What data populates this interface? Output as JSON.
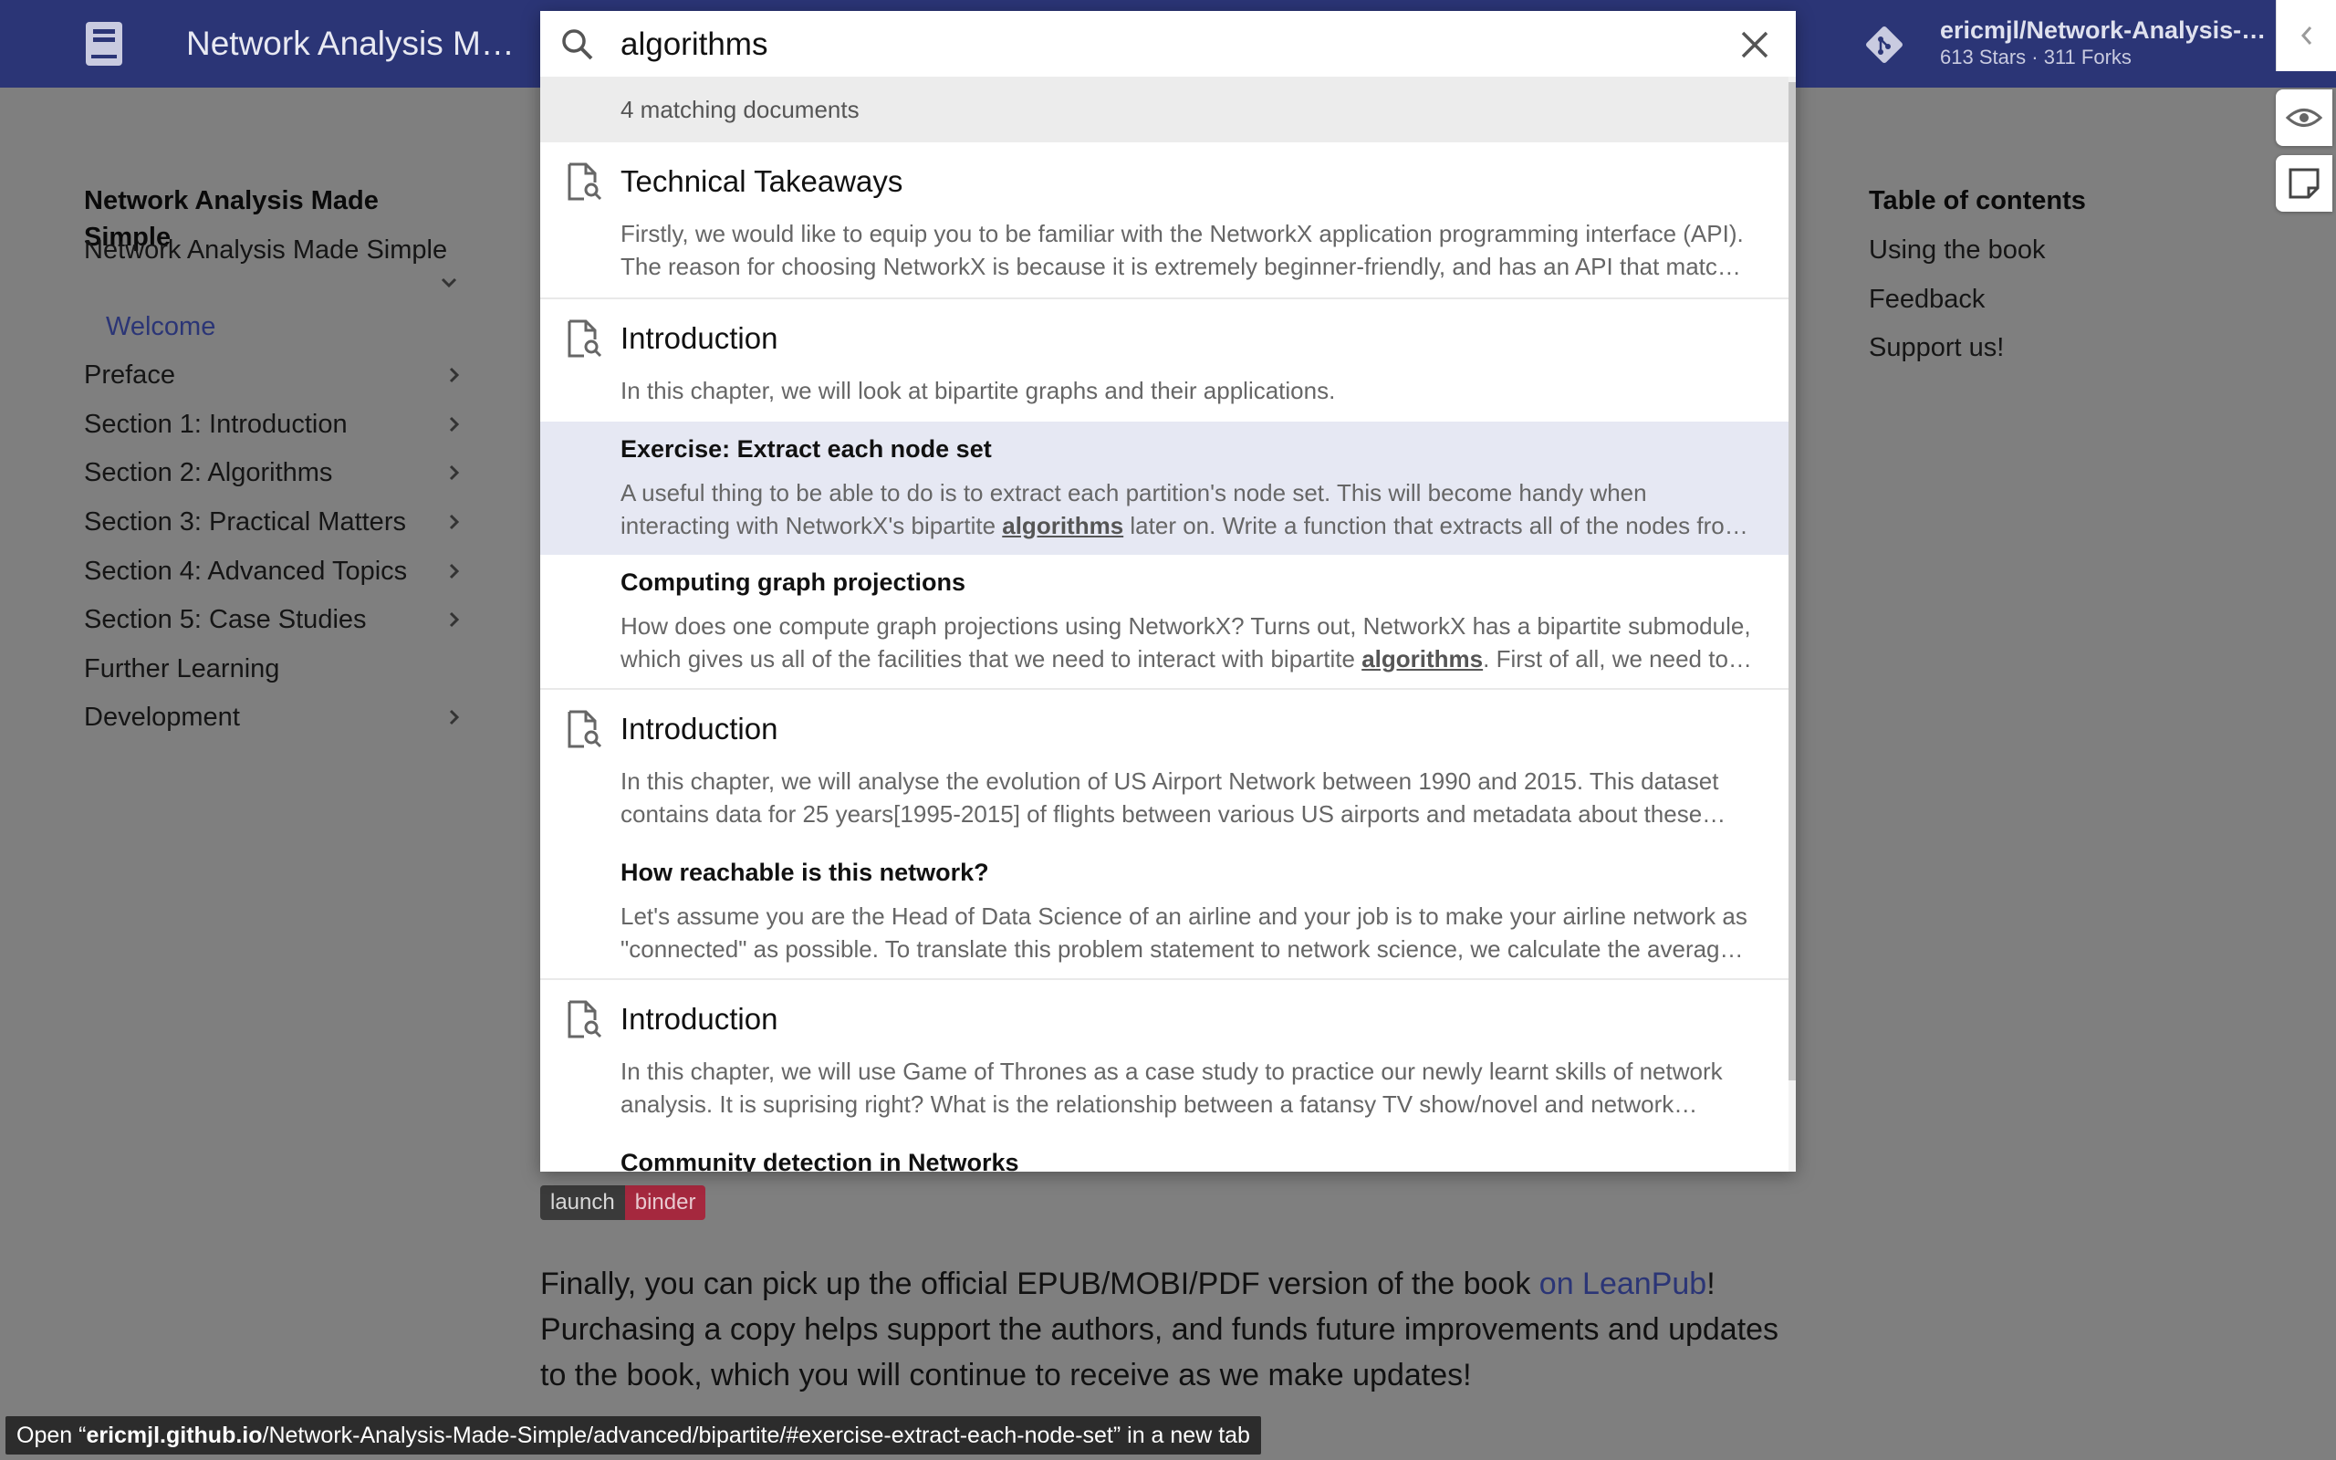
{
  "header": {
    "site_title": "Network Analysis M…",
    "repo_name": "ericmjl/Network-Analysis-…",
    "repo_facts": "613 Stars · 311 Forks"
  },
  "nav": {
    "title": "Network Analysis Made Simple",
    "items": [
      {
        "label": "Network Analysis Made Simple"
      },
      {
        "label": "Welcome"
      },
      {
        "label": "Preface"
      },
      {
        "label": "Section 1: Introduction"
      },
      {
        "label": "Section 2: Algorithms"
      },
      {
        "label": "Section 3: Practical Matters"
      },
      {
        "label": "Section 4: Advanced Topics"
      },
      {
        "label": "Section 5: Case Studies"
      },
      {
        "label": "Further Learning"
      },
      {
        "label": "Development"
      }
    ]
  },
  "toc": {
    "title": "Table of contents",
    "items": [
      {
        "label": "Using the book"
      },
      {
        "label": "Feedback"
      },
      {
        "label": "Support us!"
      }
    ]
  },
  "search": {
    "query": "algorithms",
    "meta": "4 matching documents",
    "results": [
      {
        "title": "Technical Takeaways",
        "text1": "Firstly, we would like to equip you to be familiar with the NetworkX application programming interface (API).",
        "text2": "The reason for choosing NetworkX is because it is extremely beginner-friendly, and has an API that matche…"
      },
      {
        "title": "Introduction",
        "text1": "In this chapter, we will look at bipartite graphs and their applications.",
        "sub1_title": "Exercise: Extract each node set",
        "sub1_text1": "A useful thing to be able to do is to extract each partition's node set. This will become handy when",
        "sub1_text2a": "interacting with NetworkX's bipartite ",
        "sub1_text2b": "algorithms",
        "sub1_text2c": " later on. Write a function that extracts all of the nodes fro…",
        "sub2_title": "Computing graph projections",
        "sub2_text1": "How does one compute graph projections using NetworkX? Turns out, NetworkX has a bipartite submodule,",
        "sub2_text2a": "which gives us all of the facilities that we need to interact with bipartite ",
        "sub2_text2b": "algorithms",
        "sub2_text2c": ". First of all, we need to…"
      },
      {
        "title": "Introduction",
        "text1": "In this chapter, we will analyse the evolution of US Airport Network between 1990 and 2015. This dataset",
        "text2": "contains data for 25 years[1995-2015] of flights between various US airports and metadata about these…",
        "sub1_title": "How reachable is this network?",
        "sub1_text1": "Let's assume you are the Head of Data Science of an airline and your job is to make your airline network as",
        "sub1_text2": "\"connected\" as possible. To translate this problem statement to network science, we calculate the average…"
      },
      {
        "title": "Introduction",
        "text1": "In this chapter, we will use Game of Thrones as a case study to practice our newly learnt skills of network",
        "text2": "analysis. It is suprising right? What is the relationship between a fatansy TV show/novel and network…",
        "sub1_title": "Community detection in Networks"
      }
    ]
  },
  "main": {
    "binder_left": "launch",
    "binder_right": "binder",
    "para_before": "Finally, you can pick up the official EPUB/MOBI/PDF version of the book ",
    "para_link": "on LeanPub",
    "para_after": "! Purchasing a copy helps support the authors, and funds future improvements and updates to the book, which you will continue to receive as we make updates!"
  },
  "status": {
    "prefix": "Open “",
    "domain": "ericmjl.github.io",
    "path": "/Network-Analysis-Made-Simple/advanced/bipartite/#exercise-extract-each-node-set",
    "suffix": "” in a new tab"
  },
  "colors": {
    "header": "#2b3576",
    "highlight": "#e6e8f3",
    "overlay": "#7f7f7f"
  }
}
